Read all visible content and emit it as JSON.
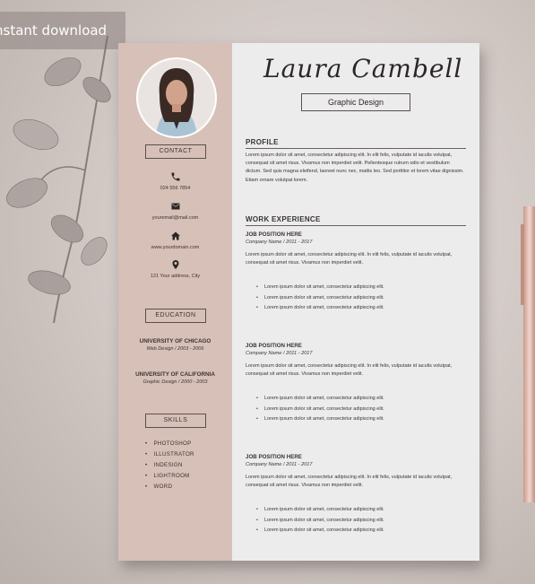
{
  "badge": {
    "text": "nstant download"
  },
  "resume": {
    "name": "Laura Cambell",
    "role": "Graphic Design",
    "sidebar": {
      "contact_title": "CONTACT",
      "phone": "024 556 7854",
      "email": "youremail@mail.com",
      "website": "www.yourdomain.com",
      "address": "121 Your address, City",
      "education_title": "EDUCATION",
      "education": [
        {
          "school": "UNIVERSITY OF CHICAGO",
          "detail": "Web Design / 2003 - 2006"
        },
        {
          "school": "UNIVERSITY OF CALIFORNIA",
          "detail": "Graphic Design / 2000 - 2003"
        }
      ],
      "skills_title": "SKILLS",
      "skills": [
        "PHOTOSHOP",
        "ILLUSTRATOR",
        "INDESIGN",
        "LIGHTROOM",
        "WORD"
      ]
    },
    "profile": {
      "title": "PROFILE",
      "text": "Lorem ipsum dolor sit amet, consectetur adipiscing elit. In elit felis, vulputate id iaculis volutpat, consequat sit amet risus. Vivamus non imperdiet velit. Pellentesque rutrum odio et vestibulum dictum. Sed quis magna eleifend, laoreet nunc nec, mattis leo. Sed porttitor et lorem vitae dignissim. Etiam ornare volutpat lorem."
    },
    "experience": {
      "title": "WORK EXPERIENCE",
      "jobs": [
        {
          "position": "JOB POSITION HERE",
          "company": "Company Name / 2011 - 2017",
          "text": "Lorem ipsum dolor sit amet, consectetur adipiscing elit. In elit felis, vulputate id iaculis volutpat, consequat sit amet risus. Vivamus non imperdiet velit.",
          "bullets": [
            "Lorem ipsum dolor sit amet, consectetur adipiscing elit.",
            "Lorem ipsum dolor sit amet, consectetur adipiscing elit.",
            "Lorem ipsum dolor sit amet, consectetur adipiscing elit."
          ]
        },
        {
          "position": "JOB POSITION HERE",
          "company": "Company Name / 2011 - 2017",
          "text": "Lorem ipsum dolor sit amet, consectetur adipiscing elit. In elit felis, vulputate id iaculis volutpat, consequat sit amet risus. Vivamus non imperdiet velit.",
          "bullets": [
            "Lorem ipsum dolor sit amet, consectetur adipiscing elit.",
            "Lorem ipsum dolor sit amet, consectetur adipiscing elit.",
            "Lorem ipsum dolor sit amet, consectetur adipiscing elit."
          ]
        },
        {
          "position": "JOB POSITION HERE",
          "company": "Company Name / 2011 - 2017",
          "text": "Lorem ipsum dolor sit amet, consectetur adipiscing elit. In elit felis, vulputate id iaculis volutpat, consequat sit amet risus. Vivamus non imperdiet velit.",
          "bullets": [
            "Lorem ipsum dolor sit amet, consectetur adipiscing elit.",
            "Lorem ipsum dolor sit amet, consectetur adipiscing elit.",
            "Lorem ipsum dolor sit amet, consectetur adipiscing elit."
          ]
        }
      ]
    },
    "icons": [
      "phone-icon",
      "mail-icon",
      "home-icon",
      "location-pin-icon"
    ],
    "colors": {
      "sidebar": "#d7c0b7",
      "paper": "#edeced",
      "text": "#3a3433"
    }
  }
}
